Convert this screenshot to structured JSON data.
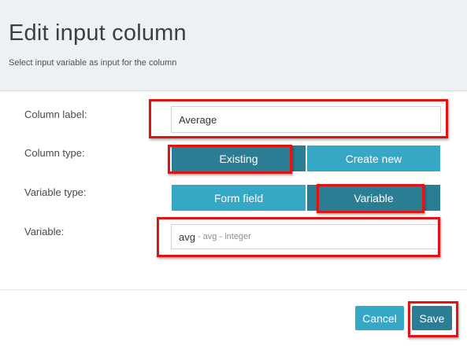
{
  "dialog": {
    "title": "Edit input column",
    "subtitle": "Select input variable as input for the column"
  },
  "form": {
    "column_label": {
      "label": "Column label:",
      "value": "Average"
    },
    "column_type": {
      "label": "Column type:",
      "options": [
        "Existing",
        "Create new"
      ],
      "selected": "Existing"
    },
    "variable_type": {
      "label": "Variable type:",
      "options": [
        "Form field",
        "Variable"
      ],
      "selected": "Variable"
    },
    "variable": {
      "label": "Variable:",
      "value_main": "avg",
      "value_detail": "- avg - integer"
    }
  },
  "footer": {
    "cancel_label": "Cancel",
    "save_label": "Save"
  },
  "colors": {
    "active": "#2a7d93",
    "inactive": "#36a8c6",
    "highlight": "#e01414"
  }
}
